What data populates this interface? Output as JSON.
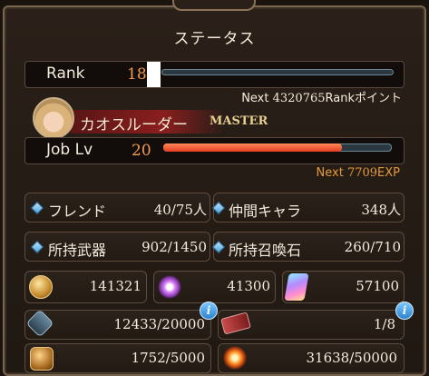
{
  "title": "ステータス",
  "rank": {
    "label": "Rank",
    "value": "18",
    "next_prefix": "Next ",
    "next_value": "4320765",
    "next_suffix": "Rankポイント"
  },
  "job": {
    "class_name": "カオスルーダー",
    "badge": "MASTER",
    "label": "Job Lv",
    "value": "20",
    "progress": 0.78,
    "next_prefix": "Next ",
    "next_value": "7709",
    "next_suffix": "EXP"
  },
  "stats": {
    "friend_label": "フレンド",
    "friend_value": "40/75人",
    "ally_label": "仲間キャラ",
    "ally_value": "348人",
    "weapons_label": "所持武器",
    "weapons_value": "902/1450",
    "summons_label": "所持召喚石",
    "summons_value": "260/710"
  },
  "currencies": {
    "rupie": "141321",
    "crystal_shards": "41300",
    "crystals": "57100"
  },
  "resources": {
    "stamina": "12433/20000",
    "tickets": "1/8",
    "bp": "1752/5000",
    "energy": "31638/50000"
  },
  "icons": {
    "diamond": "diamond-bullet-icon",
    "info": "info-icon"
  },
  "colors": {
    "accent_orange": "#f19a4f",
    "job_bar": "#e43c20",
    "panel": "#241b15"
  }
}
